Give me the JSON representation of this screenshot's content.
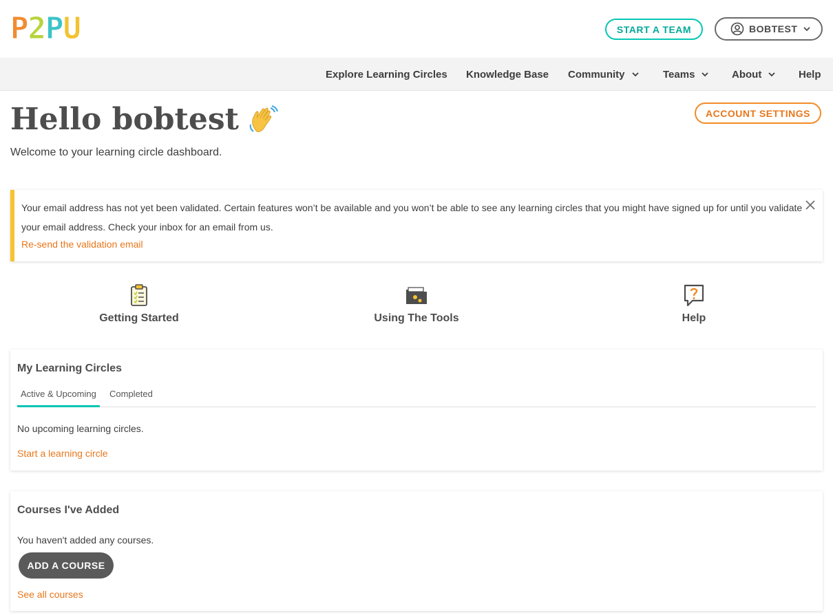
{
  "brand": {
    "logo_letters": [
      "P",
      "2",
      "P",
      "U"
    ]
  },
  "header": {
    "start_team_label": "START A TEAM",
    "user_label": "BOBTEST"
  },
  "nav": {
    "items": [
      {
        "label": "Explore Learning Circles",
        "has_dropdown": false
      },
      {
        "label": "Knowledge Base",
        "has_dropdown": false
      },
      {
        "label": "Community",
        "has_dropdown": true
      },
      {
        "label": "Teams",
        "has_dropdown": true
      },
      {
        "label": "About",
        "has_dropdown": true
      },
      {
        "label": "Help",
        "has_dropdown": false
      }
    ]
  },
  "hero": {
    "greeting": "Hello bobtest",
    "welcome": "Welcome to your learning circle dashboard.",
    "account_settings_label": "ACCOUNT SETTINGS"
  },
  "alert": {
    "message": "Your email address has not yet been validated. Certain features won’t be available and you won’t be able to see any learning circles that you might have signed up for until you validate your email address. Check your inbox for an email from us.",
    "resend_label": "Re-send the validation email"
  },
  "quick_links": [
    {
      "label": "Getting Started",
      "icon": "clipboard-checklist-icon"
    },
    {
      "label": "Using The Tools",
      "icon": "folder-gears-icon"
    },
    {
      "label": "Help",
      "icon": "question-bubble-icon"
    }
  ],
  "learning_circles": {
    "title": "My Learning Circles",
    "tabs": [
      {
        "label": "Active & Upcoming",
        "active": true
      },
      {
        "label": "Completed",
        "active": false
      }
    ],
    "empty_text": "No upcoming learning circles.",
    "start_link": "Start a learning circle"
  },
  "courses": {
    "title": "Courses I've Added",
    "empty_text": "You haven't added any courses.",
    "add_label": "ADD A COURSE",
    "see_all_link": "See all courses"
  },
  "colors": {
    "teal": "#05c6b4",
    "orange": "#e8771b",
    "alert_bar": "#f7c331",
    "dark_button": "#5a5a5a"
  }
}
